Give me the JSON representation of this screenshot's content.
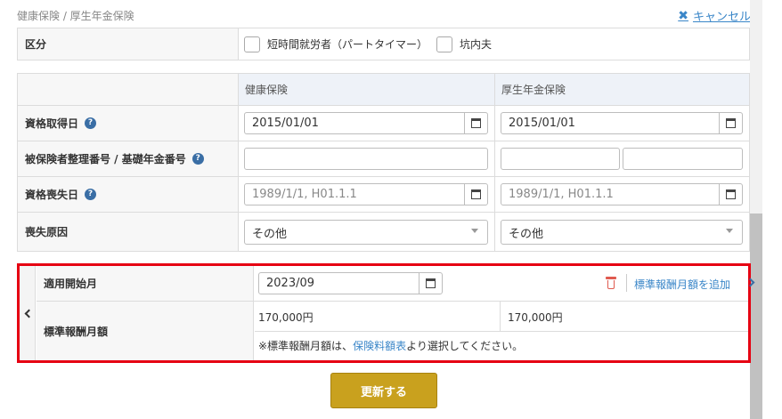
{
  "breadcrumb": "健康保険 / 厚生年金保険",
  "cancel_label": "キャンセル",
  "kubun": {
    "label": "区分",
    "options": [
      "短時間就労者（パートタイマー）",
      "坑内夫"
    ]
  },
  "columns": {
    "health": "健康保険",
    "pension": "厚生年金保険"
  },
  "rows": {
    "acquired": {
      "label": "資格取得日",
      "health_value": "2015/01/01",
      "pension_value": "2015/01/01"
    },
    "number": {
      "label": "被保険者整理番号 / 基礎年金番号"
    },
    "lost": {
      "label": "資格喪失日",
      "placeholder": "1989/1/1, H01.1.1"
    },
    "reason": {
      "label": "喪失原因",
      "health_value": "その他",
      "pension_value": "その他"
    }
  },
  "revision": {
    "start_label": "適用開始月",
    "start_value": "2023/09",
    "add_label": "標準報酬月額を追加",
    "monthly_label": "標準報酬月額",
    "health_amount": "170,000円",
    "pension_amount": "170,000円",
    "note_prefix": "※標準報酬月額は、",
    "note_link": "保険料額表",
    "note_suffix": "より選択してください。"
  },
  "submit_label": "更新する"
}
